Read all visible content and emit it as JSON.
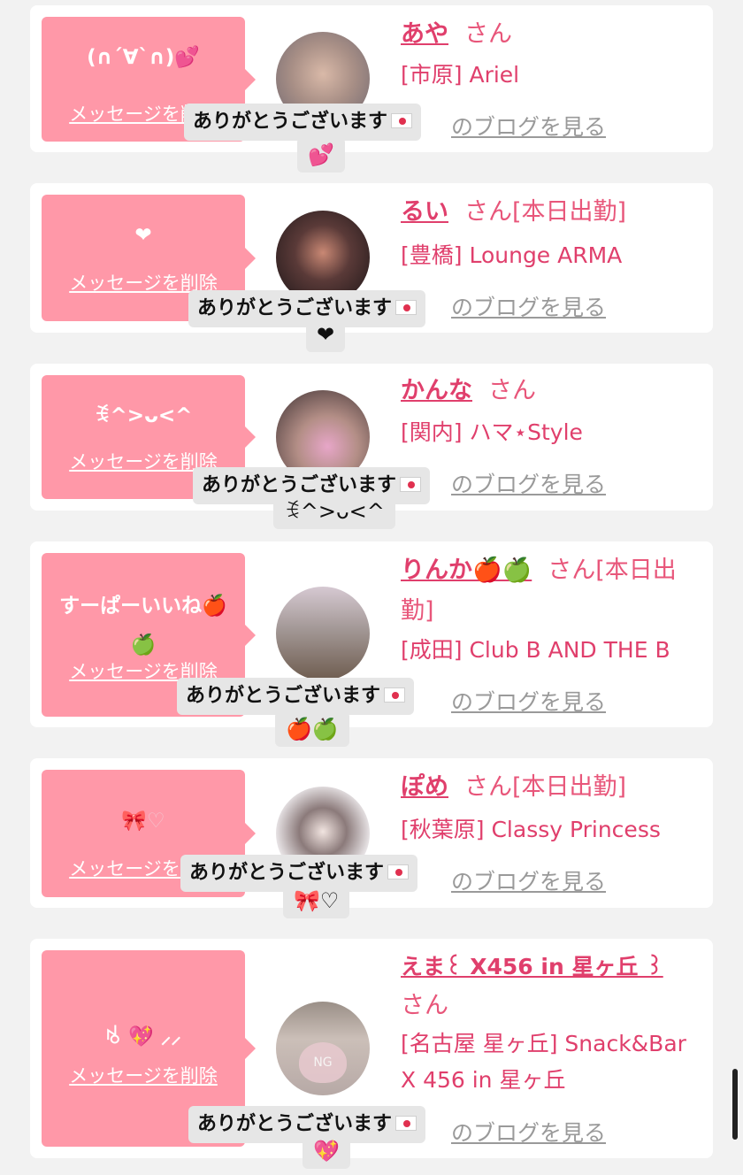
{
  "labels": {
    "delete": "メッセージを削除",
    "thanks": "ありがとうございます",
    "blog": "のブログを見る",
    "san": "さん"
  },
  "cards": [
    {
      "message": "(∩´∀`∩)💕",
      "name": "あや",
      "status": "",
      "area": "[市原]",
      "shop": "Ariel",
      "reply": "💕"
    },
    {
      "message": "❤",
      "name": "るい",
      "status": "[本日出勤]",
      "area": "[豊橋]",
      "shop": "Lounge ARMA",
      "reply": "❤"
    },
    {
      "message": "ꉂ^>ᴗ<^",
      "name": "かんな",
      "status": "",
      "area": "[関内]",
      "shop": "ハマ⋆Style",
      "reply": "ꉂ^>ᴗ<^"
    },
    {
      "message": "すーぱーいいね🍎🍏",
      "name": "りんか🍎🍏",
      "status": "[本日出勤]",
      "area": "[成田]",
      "shop": "Club B AND THE B",
      "reply": "🍎🍏"
    },
    {
      "message": "🎀♡",
      "name": "ぽめ",
      "status": "[本日出勤]",
      "area": "[秋葉原]",
      "shop": "Classy Princess",
      "reply": "🎀♡"
    },
    {
      "message": "ꂚ 💖 ⸝⸝",
      "name": "えま꒰ X456 in 星ヶ丘 ꒱",
      "status": "",
      "area": "[名古屋 星ヶ丘]",
      "shop": "Snack&Bar X 456 in 星ヶ丘",
      "reply": "💖"
    }
  ],
  "colors": {
    "background": "#f2f2f2",
    "card": "#ffffff",
    "bubble": "#ff98a8",
    "name": "#e03f6c",
    "link_gray": "#9a9a9a"
  }
}
